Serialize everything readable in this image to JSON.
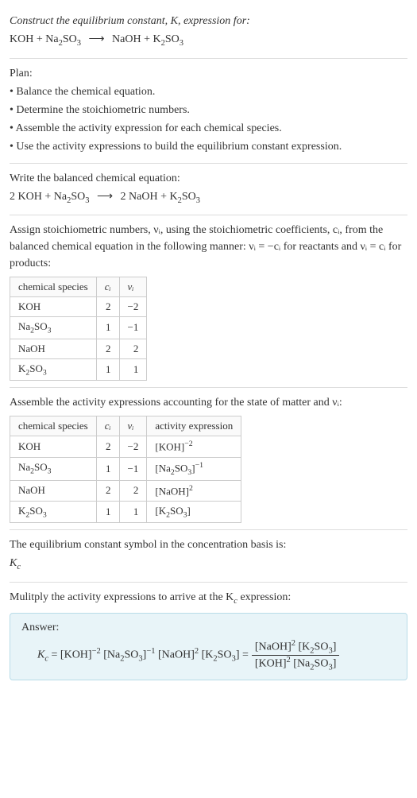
{
  "s1": {
    "intro": "Construct the equilibrium constant, K, expression for:",
    "eq_lhs1": "KOH + Na",
    "eq_lhs2": "SO",
    "eq_rhs1": "NaOH + K",
    "eq_rhs2": "SO",
    "sub2": "2",
    "sub3": "3",
    "arrow": "⟶"
  },
  "s2": {
    "plan": "Plan:",
    "b1": "• Balance the chemical equation.",
    "b2": "• Determine the stoichiometric numbers.",
    "b3": "• Assemble the activity expression for each chemical species.",
    "b4": "• Use the activity expressions to build the equilibrium constant expression."
  },
  "s3": {
    "intro": "Write the balanced chemical equation:",
    "lhs1": "2 KOH + Na",
    "lhs2": "SO",
    "rhs1": "2 NaOH + K",
    "rhs2": "SO",
    "sub2": "2",
    "sub3": "3",
    "arrow": "⟶"
  },
  "s4": {
    "p1": "Assign stoichiometric numbers, νᵢ, using the stoichiometric coefficients, cᵢ, from the balanced chemical equation in the following manner: νᵢ = −cᵢ for reactants and νᵢ = cᵢ for products:",
    "h1": "chemical species",
    "h2": "cᵢ",
    "h3": "νᵢ",
    "r1c1": "KOH",
    "r1c2": "2",
    "r1c3": "−2",
    "r2c1a": "Na",
    "r2c1b": "SO",
    "r2c2": "1",
    "r2c3": "−1",
    "r3c1": "NaOH",
    "r3c2": "2",
    "r3c3": "2",
    "r4c1a": "K",
    "r4c1b": "SO",
    "r4c2": "1",
    "r4c3": "1",
    "sub2": "2",
    "sub3": "3"
  },
  "s5": {
    "p1": "Assemble the activity expressions accounting for the state of matter and νᵢ:",
    "h1": "chemical species",
    "h2": "cᵢ",
    "h3": "νᵢ",
    "h4": "activity expression",
    "r1c1": "KOH",
    "r1c2": "2",
    "r1c3": "−2",
    "r1c4a": "[KOH]",
    "r1c4s": "−2",
    "r2c1a": "Na",
    "r2c1b": "SO",
    "r2c2": "1",
    "r2c3": "−1",
    "r2c4a": "[Na",
    "r2c4b": "SO",
    "r2c4c": "]",
    "r2c4s": "−1",
    "r3c1": "NaOH",
    "r3c2": "2",
    "r3c3": "2",
    "r3c4a": "[NaOH]",
    "r3c4s": "2",
    "r4c1a": "K",
    "r4c1b": "SO",
    "r4c2": "1",
    "r4c3": "1",
    "r4c4a": "[K",
    "r4c4b": "SO",
    "r4c4c": "]",
    "sub2": "2",
    "sub3": "3"
  },
  "s6": {
    "p1": "The equilibrium constant symbol in the concentration basis is:",
    "sym": "K",
    "subc": "c"
  },
  "s7": {
    "p1": "Mulitply the activity expressions to arrive at the K",
    "p1b": " expression:",
    "subc": "c",
    "ans": "Answer:",
    "Kc": "K",
    "Kcs": "c",
    "eq": " = ",
    "t1": "[KOH]",
    "e1": "−2",
    "t2a": " [Na",
    "t2b": "SO",
    "t2c": "]",
    "e2": "−1",
    "t3": " [NaOH]",
    "e3": "2",
    "t4a": " [K",
    "t4b": "SO",
    "t4c": "] = ",
    "num1": "[NaOH]",
    "nume1": "2",
    "num2a": " [K",
    "num2b": "SO",
    "num2c": "]",
    "den1": "[KOH]",
    "dene1": "2",
    "den2a": " [Na",
    "den2b": "SO",
    "den2c": "]",
    "sub2": "2",
    "sub3": "3"
  }
}
